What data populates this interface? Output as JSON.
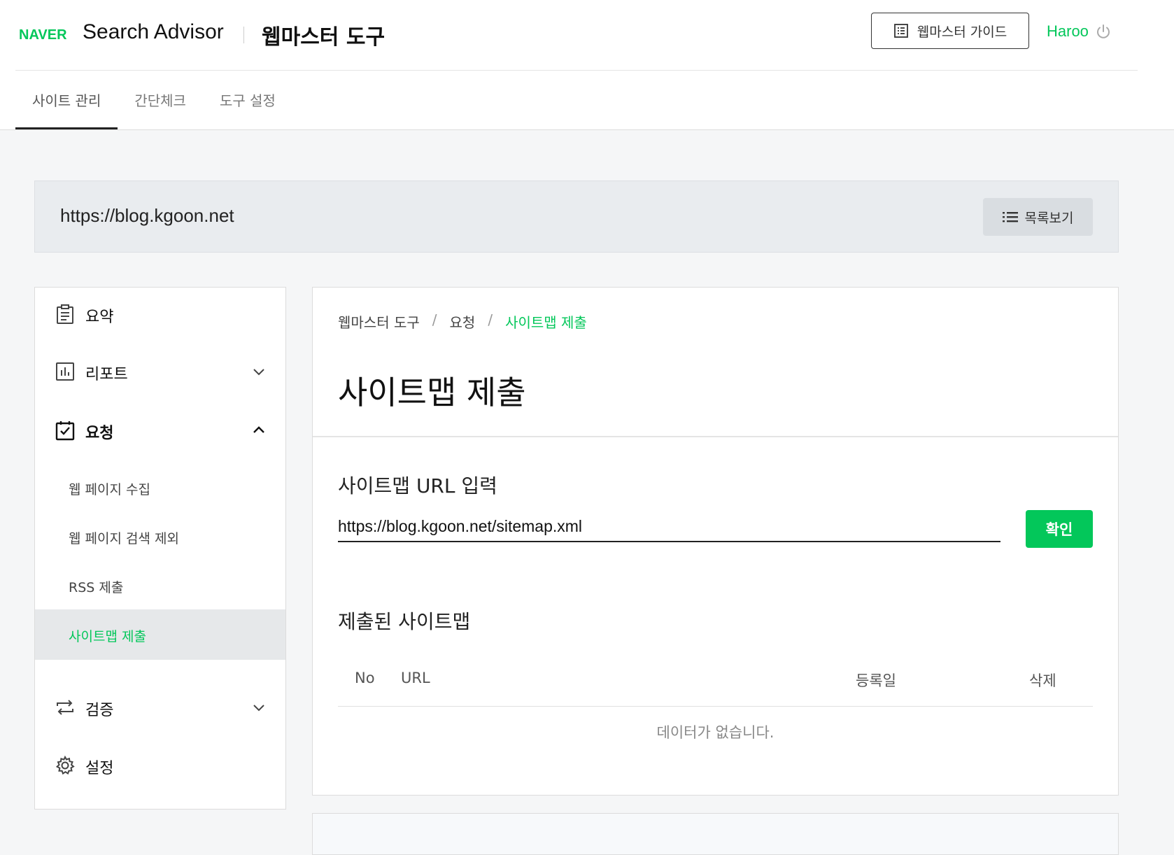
{
  "header": {
    "brand": "NAVER",
    "product": "Search Advisor",
    "tool_title": "웹마스터 도구",
    "guide_button": "웹마스터 가이드",
    "username": "Haroo"
  },
  "tabs": [
    {
      "label": "사이트 관리",
      "active": true
    },
    {
      "label": "간단체크",
      "active": false
    },
    {
      "label": "도구 설정",
      "active": false
    }
  ],
  "site": {
    "url": "https://blog.kgoon.net",
    "list_button": "목록보기"
  },
  "sidebar": {
    "summary": "요약",
    "report": "리포트",
    "request": "요청",
    "sub_items": [
      {
        "label": "웹 페이지 수집",
        "active": false
      },
      {
        "label": "웹 페이지 검색 제외",
        "active": false
      },
      {
        "label": "RSS 제출",
        "active": false
      },
      {
        "label": "사이트맵 제출",
        "active": true
      }
    ],
    "verify": "검증",
    "settings": "설정"
  },
  "main": {
    "breadcrumb": [
      "웹마스터 도구",
      "요청",
      "사이트맵 제출"
    ],
    "title": "사이트맵 제출",
    "input_label": "사이트맵 URL 입력",
    "input_value": "https://blog.kgoon.net/sitemap.xml",
    "confirm_button": "확인",
    "submitted_label": "제출된 사이트맵",
    "table_headers": {
      "no": "No",
      "url": "URL",
      "date": "등록일",
      "delete": "삭제"
    },
    "empty_message": "데이터가 없습니다."
  },
  "colors": {
    "accent": "#03c75a",
    "text": "#222222",
    "muted": "#888888"
  }
}
